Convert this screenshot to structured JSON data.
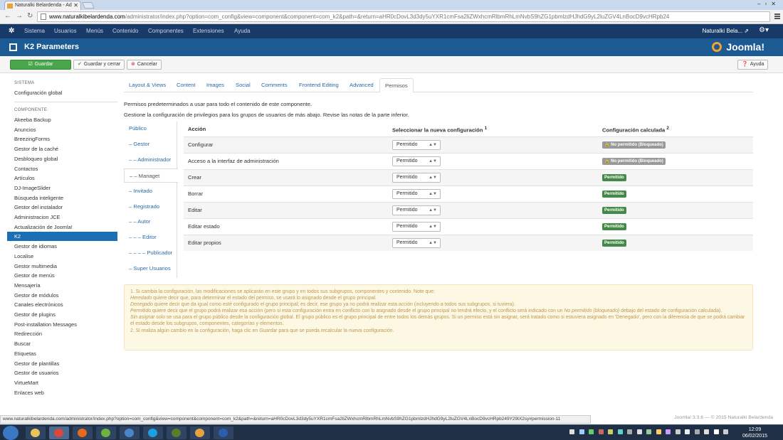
{
  "browser": {
    "tab_title": "Naturalki Belardenda - Ad",
    "tab_close": "✕",
    "url_domain": "www.naturalkibelardenda.com",
    "url_path": "/administrator/index.php?option=com_config&view=component&component=com_k2&path=&return=aHR0cDovL3d3dy5uYXR1cmFsa2liZWxhcmRlbmRhLmNvbS9hZG1pbmlzdHJhdG9yL2luZGV4LnBocD9vcHRpb24"
  },
  "joomla_nav": {
    "menu": [
      "Sistema",
      "Usuarios",
      "Menús",
      "Contenido",
      "Componentes",
      "Extensiones",
      "Ayuda"
    ],
    "user": "Naturalki Bela...",
    "user_icon": "external-link-icon",
    "settings_icon": "gear-icon"
  },
  "header": {
    "title": "K2 Parameters",
    "brand": "Joomla!"
  },
  "toolbar": {
    "save": "Guardar",
    "save_close": "Guardar y cerrar",
    "cancel": "Cancelar",
    "help": "Ayuda"
  },
  "sidebar": {
    "system_heading": "SISTEMA",
    "global_config": "Configuración global",
    "component_heading": "COMPONENTE",
    "items": [
      "Akeeba Backup",
      "Anuncios",
      "BreezingForms",
      "Gestor de la caché",
      "Desbloqueo global",
      "Contactos",
      "Artículos",
      "DJ-ImageSlider",
      "Búsqueda inteligente",
      "Gestor del instalador",
      "Administracion JCE",
      "Actualización de Joomla!",
      "K2",
      "Gestor de idiomas",
      "Localise",
      "Gestor multimedia",
      "Gestor de menús",
      "Mensajería",
      "Gestor de módulos",
      "Canales electrónicos",
      "Gestor de plugins",
      "Post-installation Messages",
      "Redirección",
      "Buscar",
      "Etiquetas",
      "Gestor de plantillas",
      "Gestor de usuarios",
      "VirtueMart",
      "Enlaces web"
    ],
    "active": "K2"
  },
  "tabs": [
    "Layout & Views",
    "Content",
    "Images",
    "Social",
    "Comments",
    "Frontend Editing",
    "Advanced",
    "Permisos"
  ],
  "active_tab": "Permisos",
  "intro": {
    "line1": "Permisos predeterminados a usar para todo el contenido de este componente.",
    "line2": "Gestione la configuración de privilegios para los grupos de usuarios de más abajo. Revise las notas de la parte inferior."
  },
  "groups": [
    "Público",
    "– Gestor",
    "– – Administrador",
    "– – Managet",
    "– Invitado",
    "– Registrado",
    "– – Autor",
    "– – – Editor",
    "– – – – Publicador",
    "– Super Usuarios"
  ],
  "active_group": "– – Managet",
  "permissions": {
    "col_action": "Acción",
    "col_new": "Seleccionar la nueva configuración",
    "col_new_sup": "1",
    "col_calc": "Configuración calculada",
    "col_calc_sup": "2",
    "rows": [
      {
        "action": "Configurar",
        "setting": "Permitido",
        "calculated": "No permitido (Bloqueado)",
        "calc_state": "locked"
      },
      {
        "action": "Acceso a la interfaz de administración",
        "setting": "Permitido",
        "calculated": "No permitido (Bloqueado)",
        "calc_state": "locked"
      },
      {
        "action": "Crear",
        "setting": "Permitido",
        "calculated": "Permitido",
        "calc_state": "allowed"
      },
      {
        "action": "Borrar",
        "setting": "Permitido",
        "calculated": "Permitido",
        "calc_state": "allowed"
      },
      {
        "action": "Editar",
        "setting": "Permitido",
        "calculated": "Permitido",
        "calc_state": "allowed"
      },
      {
        "action": "Editar estado",
        "setting": "Permitido",
        "calculated": "Permitido",
        "calc_state": "allowed"
      },
      {
        "action": "Editar propios",
        "setting": "Permitido",
        "calculated": "Permitido",
        "calc_state": "allowed"
      }
    ]
  },
  "notes": {
    "n1": "1. Si cambia la configuración, las modificaciones se aplicarán en este grupo y en todos sus subgrupos, componentes y contenido. Note que:",
    "heredado_term": "Heredado",
    "heredado": " quiere decir que, para determinar el estado del permiso, se usará lo asignado desde el grupo principal.",
    "denegado_term": "Denegado",
    "denegado": " quiere decir que da igual como esté configurado el grupo principal; es decir, ese grupo ya no podrá realizar esta acción (incluyendo a todos sus subgrupos, si tuviera).",
    "permitido_term": "Permitido",
    "permitido_a": " quiere decir que el grupo podrá realizar esa acción (pero si esta configuración entra en conflicto con lo asignado desde el grupo principal no tendrá efecto, y el conflicto será indicado con un ",
    "permitido_em": "No permitido (bloqueado)",
    "permitido_b": " debajo del estado de configuración calculada).",
    "sin_term": "Sin asignar",
    "sin": " solo se usa para el grupo público desde la configuración global. El grupo público es el grupo principal de entre todos los demás grupos. Si un permiso está sin asignar, será tratado como si estuviera asignado en 'Denegado', pero con la diferencia de que se podrá cambiar el estado desde los subgrupos, componentes, categorías y elementos.",
    "n2a": "2. Si realiza algún cambio en la configuración, haga clic en ",
    "n2_em": "Guardar",
    "n2b": " para que se pueda recalcular la nueva configuración."
  },
  "status_url": "www.naturalkibelardenda.com/administrator/index.php?option=com_config&view=component&component=com_k2&path=&return=aHR0cDovL3d3dy5uYXR1cmFsa2liZWxhcmRlbmRhLmNvbS9hZG1pbmlzdHJhdG9yL2luZGV4LnBocD9vcHRpb249Y29tX2sy#permission-11",
  "footer": "Joomla! 3.3.6  —  © 2015 Naturalki Belardenda",
  "taskbar": {
    "apps": [
      "windows-explorer",
      "chrome",
      "firefox",
      "utorrent",
      "network",
      "skype",
      "dreamweaver",
      "media-player",
      "word"
    ],
    "active": "chrome",
    "time": "12:09",
    "date": "06/02/2015"
  },
  "colors": {
    "nav": "#173a68",
    "title_bar": "#1c5a94",
    "active_item": "#1c6fb5",
    "success": "#468847",
    "save": "#4aa64a"
  }
}
